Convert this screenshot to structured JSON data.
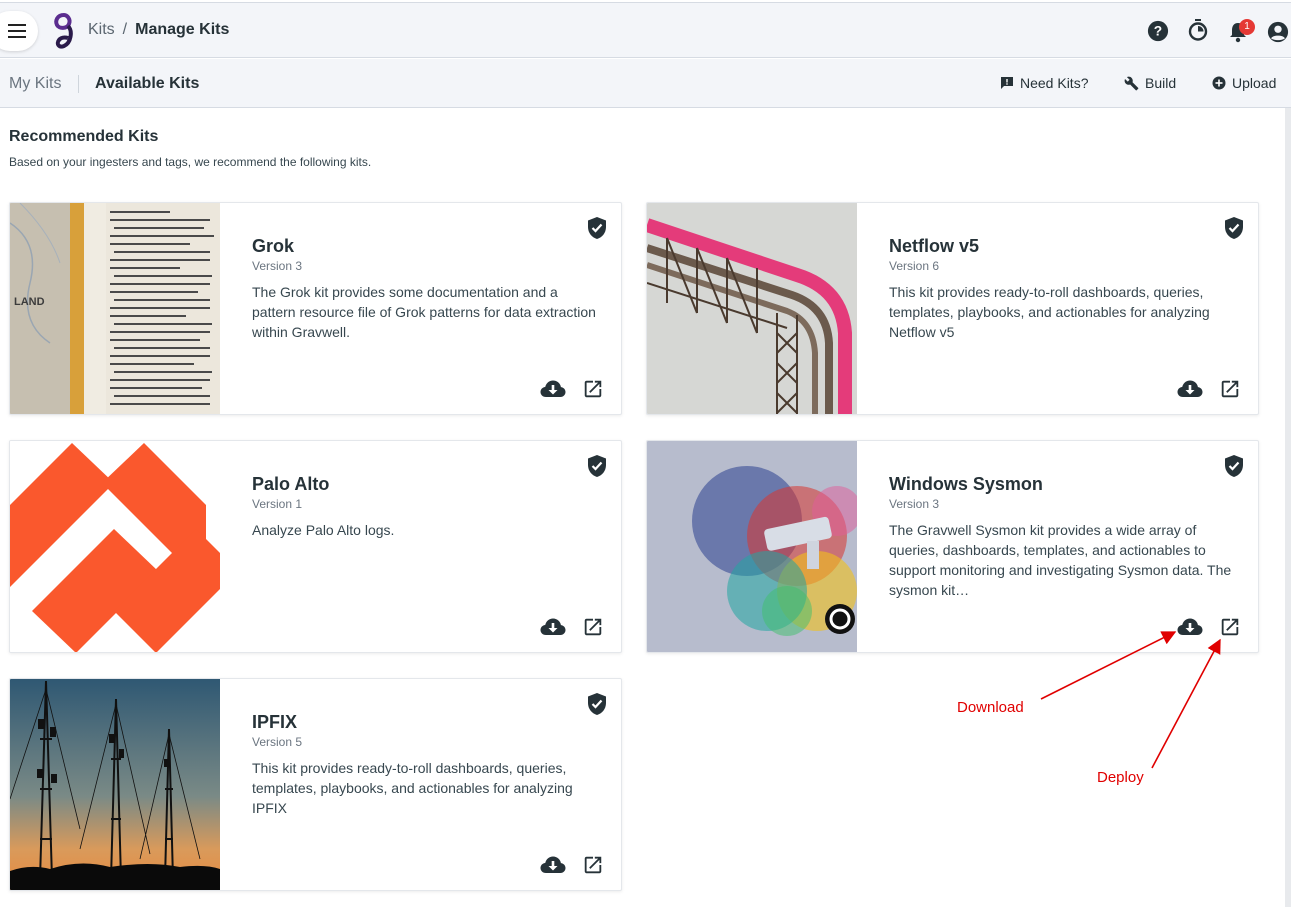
{
  "header": {
    "breadcrumb_root": "Kits",
    "breadcrumb_separator": "/",
    "breadcrumb_current": "Manage Kits",
    "notification_count": "1",
    "icons": [
      "menu-icon",
      "help-icon",
      "timer-icon",
      "bell-icon",
      "account-icon"
    ]
  },
  "tabs": {
    "my_kits": "My Kits",
    "available_kits": "Available Kits"
  },
  "actions": {
    "need_kits": "Need Kits?",
    "build": "Build",
    "upload": "Upload"
  },
  "section": {
    "title": "Recommended Kits",
    "subtitle": "Based on your ingesters and tags, we recommend the following kits."
  },
  "kits": [
    {
      "name": "Grok",
      "version": "Version 3",
      "description": "The Grok kit provides some documentation and a pattern resource file of Grok patterns for data extraction within Gravwell."
    },
    {
      "name": "Netflow v5",
      "version": "Version 6",
      "description": "This kit provides ready-to-roll dashboards, queries, templates, playbooks, and actionables for analyzing Netflow v5"
    },
    {
      "name": "Palo Alto",
      "version": "Version 1",
      "description": "Analyze Palo Alto logs."
    },
    {
      "name": "Windows Sysmon",
      "version": "Version 3",
      "description": "The Gravwell Sysmon kit provides a wide array of queries, dashboards, templates, and actionables to support monitoring and investigating Sysmon data. The sysmon kit…"
    },
    {
      "name": "IPFIX",
      "version": "Version 5",
      "description": "This kit provides ready-to-roll dashboards, queries, templates, playbooks, and actionables for analyzing IPFIX"
    }
  ],
  "annotations": {
    "download": "Download",
    "deploy": "Deploy"
  },
  "colors": {
    "accent": "#263238",
    "annotation": "#e00000",
    "palo_alto": "#fa582d",
    "badge": "#e53935"
  }
}
